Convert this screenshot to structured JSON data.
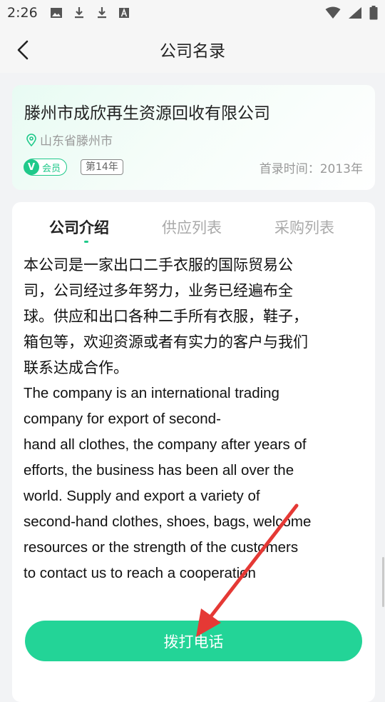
{
  "status_bar": {
    "time": "2:26",
    "left_icons": [
      "image-icon",
      "download-icon",
      "download-icon",
      "text-a-icon"
    ],
    "right_icons": [
      "wifi-icon",
      "signal-icon",
      "battery-icon"
    ]
  },
  "header": {
    "title": "公司名录",
    "back_icon": "chevron-left-icon"
  },
  "company": {
    "name": "滕州市成欣再生资源回收有限公司",
    "location": "山东省滕州市",
    "member_label": "会员",
    "year_badge": "第14年",
    "listed_since": "首录时间：2013年"
  },
  "tabs": [
    {
      "label": "公司介绍",
      "active": true
    },
    {
      "label": "供应列表",
      "active": false
    },
    {
      "label": "采购列表",
      "active": false
    }
  ],
  "intro": {
    "zh": "本公司是一家出口二手衣服的国际贸易公\n司，公司经过多年努力，业务已经遍布全\n球。供应和出口各种二手所有衣服，鞋子，\n箱包等，欢迎资源或者有实力的客户与我们\n联系达成合作。",
    "en": "The company is an international trading\ncompany for export of second-\nhand all clothes, the company after years of\nefforts, the business has been all over the\nworld. Supply and export a variety of\nsecond-hand clothes, shoes, bags, welcome\nresources or the strength of the customers\nto contact us to reach a cooperation"
  },
  "call_button": {
    "label": "拨打电话"
  },
  "colors": {
    "accent": "#23d497",
    "annotation_arrow": "#e53935"
  }
}
